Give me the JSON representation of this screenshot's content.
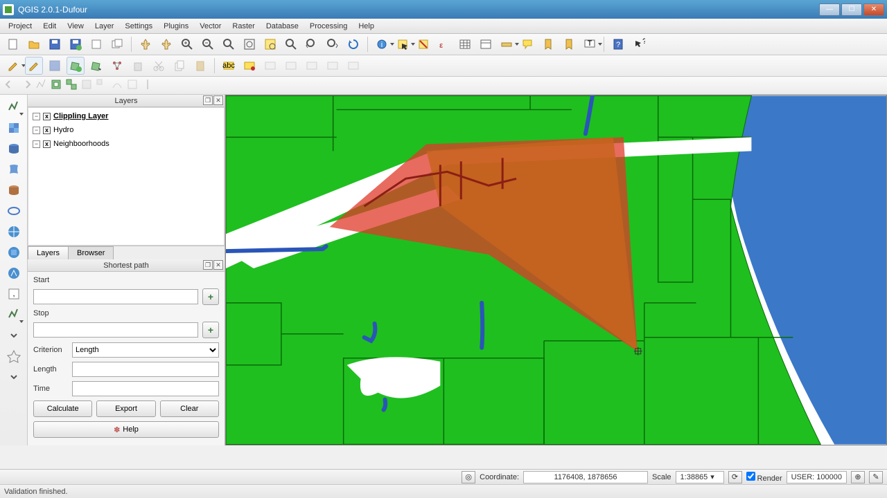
{
  "window": {
    "title": "QGIS 2.0.1-Dufour"
  },
  "menus": [
    "Project",
    "Edit",
    "View",
    "Layer",
    "Settings",
    "Plugins",
    "Vector",
    "Raster",
    "Database",
    "Processing",
    "Help"
  ],
  "panels": {
    "layers_title": "Layers",
    "shortest_title": "Shortest path",
    "tabs": {
      "layers": "Layers",
      "browser": "Browser"
    }
  },
  "layers": [
    {
      "name": "Clippling Layer",
      "color": "#c7e0b8",
      "checked": "x",
      "active": true
    },
    {
      "name": "Hydro",
      "color": "#3066c8",
      "checked": "x",
      "active": false
    },
    {
      "name": "Neighboorhoods",
      "color": "#2bbd2b",
      "checked": "x",
      "active": false
    }
  ],
  "shortest_path": {
    "start_label": "Start",
    "stop_label": "Stop",
    "criterion_label": "Criterion",
    "criterion_value": "Length",
    "length_label": "Length",
    "time_label": "Time",
    "calculate": "Calculate",
    "export": "Export",
    "clear": "Clear",
    "help": "Help"
  },
  "status": {
    "coordinate_label": "Coordinate:",
    "coordinate_value": "1176408, 1878656",
    "scale_label": "Scale",
    "scale_value": "1:38865",
    "render_label": "Render",
    "user_crs": "USER: 100000"
  },
  "validation": "Validation finished."
}
